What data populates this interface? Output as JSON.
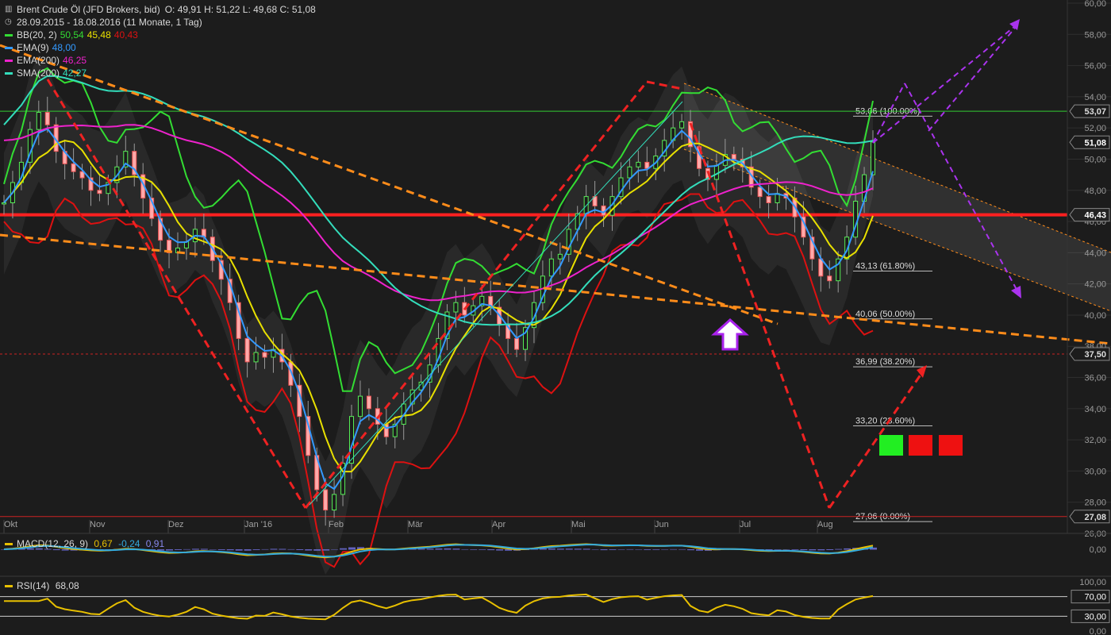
{
  "header": {
    "title": "Brent Crude Öl (JFD Brokers, bid)",
    "ohlc": "O: 49,91  H: 51,22  L: 49,68  C: 51,08",
    "period": "28.09.2015 - 18.08.2016 (11 Monate, 1 Tag)"
  },
  "indicators": [
    {
      "name": "BB(20, 2)",
      "values": [
        "50,54",
        "45,48",
        "40,43"
      ],
      "colors": [
        "#33dd33",
        "#e8e000",
        "#dd1111"
      ]
    },
    {
      "name": "EMA(9)",
      "values": [
        "48,00"
      ],
      "colors": [
        "#3399ff"
      ]
    },
    {
      "name": "EMA(200)",
      "values": [
        "46,25"
      ],
      "colors": [
        "#ee22cc"
      ]
    },
    {
      "name": "SMA(200)",
      "values": [
        "42,27"
      ],
      "colors": [
        "#33ddbb"
      ]
    }
  ],
  "macd": {
    "label": "MACD(12, 26, 9)",
    "values": [
      "0,67",
      "-0,24",
      "0,91"
    ],
    "colors": [
      "#e8c000",
      "#33aadd",
      "#8888ee"
    ],
    "axis": [
      "0,00"
    ]
  },
  "rsi": {
    "label": "RSI(14)",
    "value": "68,08",
    "color": "#e8c000",
    "axis": [
      "100,00",
      "70,00",
      "30,00",
      "0,00"
    ]
  },
  "chart_data": {
    "type": "candlestick",
    "ylim": [
      26,
      60
    ],
    "y_ticks": [
      "26,00",
      "28,00",
      "30,00",
      "32,00",
      "34,00",
      "36,00",
      "38,00",
      "40,00",
      "42,00",
      "44,00",
      "46,00",
      "48,00",
      "50,00",
      "52,00",
      "54,00",
      "56,00",
      "58,00",
      "60,00"
    ],
    "x_months": [
      "Okt",
      "Nov",
      "Dez",
      "Jan '16",
      "Feb",
      "Mär",
      "Apr",
      "Mai",
      "Jun",
      "Jul",
      "Aug"
    ],
    "price_tags": [
      {
        "value": 53.07,
        "label": "53,07",
        "bg": "#1c1c1c",
        "fg": "#dddddd",
        "line": "#33cc33"
      },
      {
        "value": 51.08,
        "label": "51,08",
        "bg": "#1c1c1c",
        "fg": "#ffffff",
        "line": null
      },
      {
        "value": 46.43,
        "label": "46,43",
        "bg": "#222222",
        "fg": "#ffffff",
        "line": "#ff2020"
      },
      {
        "value": 37.5,
        "label": "37,50",
        "bg": "#1c1c1c",
        "fg": "#dddddd",
        "line": "#cc2222"
      },
      {
        "value": 27.08,
        "label": "27,08",
        "bg": "#1c1c1c",
        "fg": "#dddddd",
        "line": "#cc2222"
      }
    ],
    "fibonacci": [
      {
        "value": 53.06,
        "label": "53,06 (100.00%)"
      },
      {
        "value": 43.13,
        "label": "43,13 (61.80%)"
      },
      {
        "value": 40.06,
        "label": "40,06 (50.00%)"
      },
      {
        "value": 36.99,
        "label": "36,99 (38.20%)"
      },
      {
        "value": 33.2,
        "label": "33,20 (23.60%)"
      },
      {
        "value": 27.06,
        "label": "27,06 (0.00%)"
      }
    ],
    "close_series": [
      47.2,
      48.5,
      49.8,
      51.9,
      53.0,
      52.2,
      50.5,
      49.7,
      49.2,
      48.8,
      48.0,
      47.8,
      48.5,
      49.5,
      50.5,
      49.0,
      47.5,
      46.2,
      44.8,
      44.0,
      44.3,
      44.7,
      45.5,
      45.0,
      43.5,
      42.3,
      40.8,
      38.5,
      37.0,
      37.6,
      37.3,
      37.8,
      37.0,
      35.5,
      33.5,
      31.0,
      28.8,
      27.5,
      28.5,
      30.5,
      33.5,
      34.8,
      34.0,
      33.0,
      32.2,
      33.0,
      34.3,
      35.2,
      35.7,
      36.8,
      38.5,
      40.2,
      40.8,
      40.0,
      40.6,
      41.2,
      40.5,
      39.4,
      38.5,
      37.8,
      39.2,
      40.8,
      42.5,
      43.6,
      43.9,
      45.5,
      46.5,
      47.6,
      47.0,
      46.4,
      47.6,
      48.8,
      49.5,
      49.8,
      49.4,
      50.2,
      51.2,
      52.0,
      52.4,
      50.8,
      49.4,
      48.7,
      49.6,
      50.3,
      50.0,
      49.5,
      48.2,
      47.6,
      47.2,
      47.8,
      47.5,
      46.3,
      45.0,
      43.6,
      42.5,
      42.2,
      43.6,
      45.0,
      47.3,
      49.0,
      51.1
    ]
  }
}
